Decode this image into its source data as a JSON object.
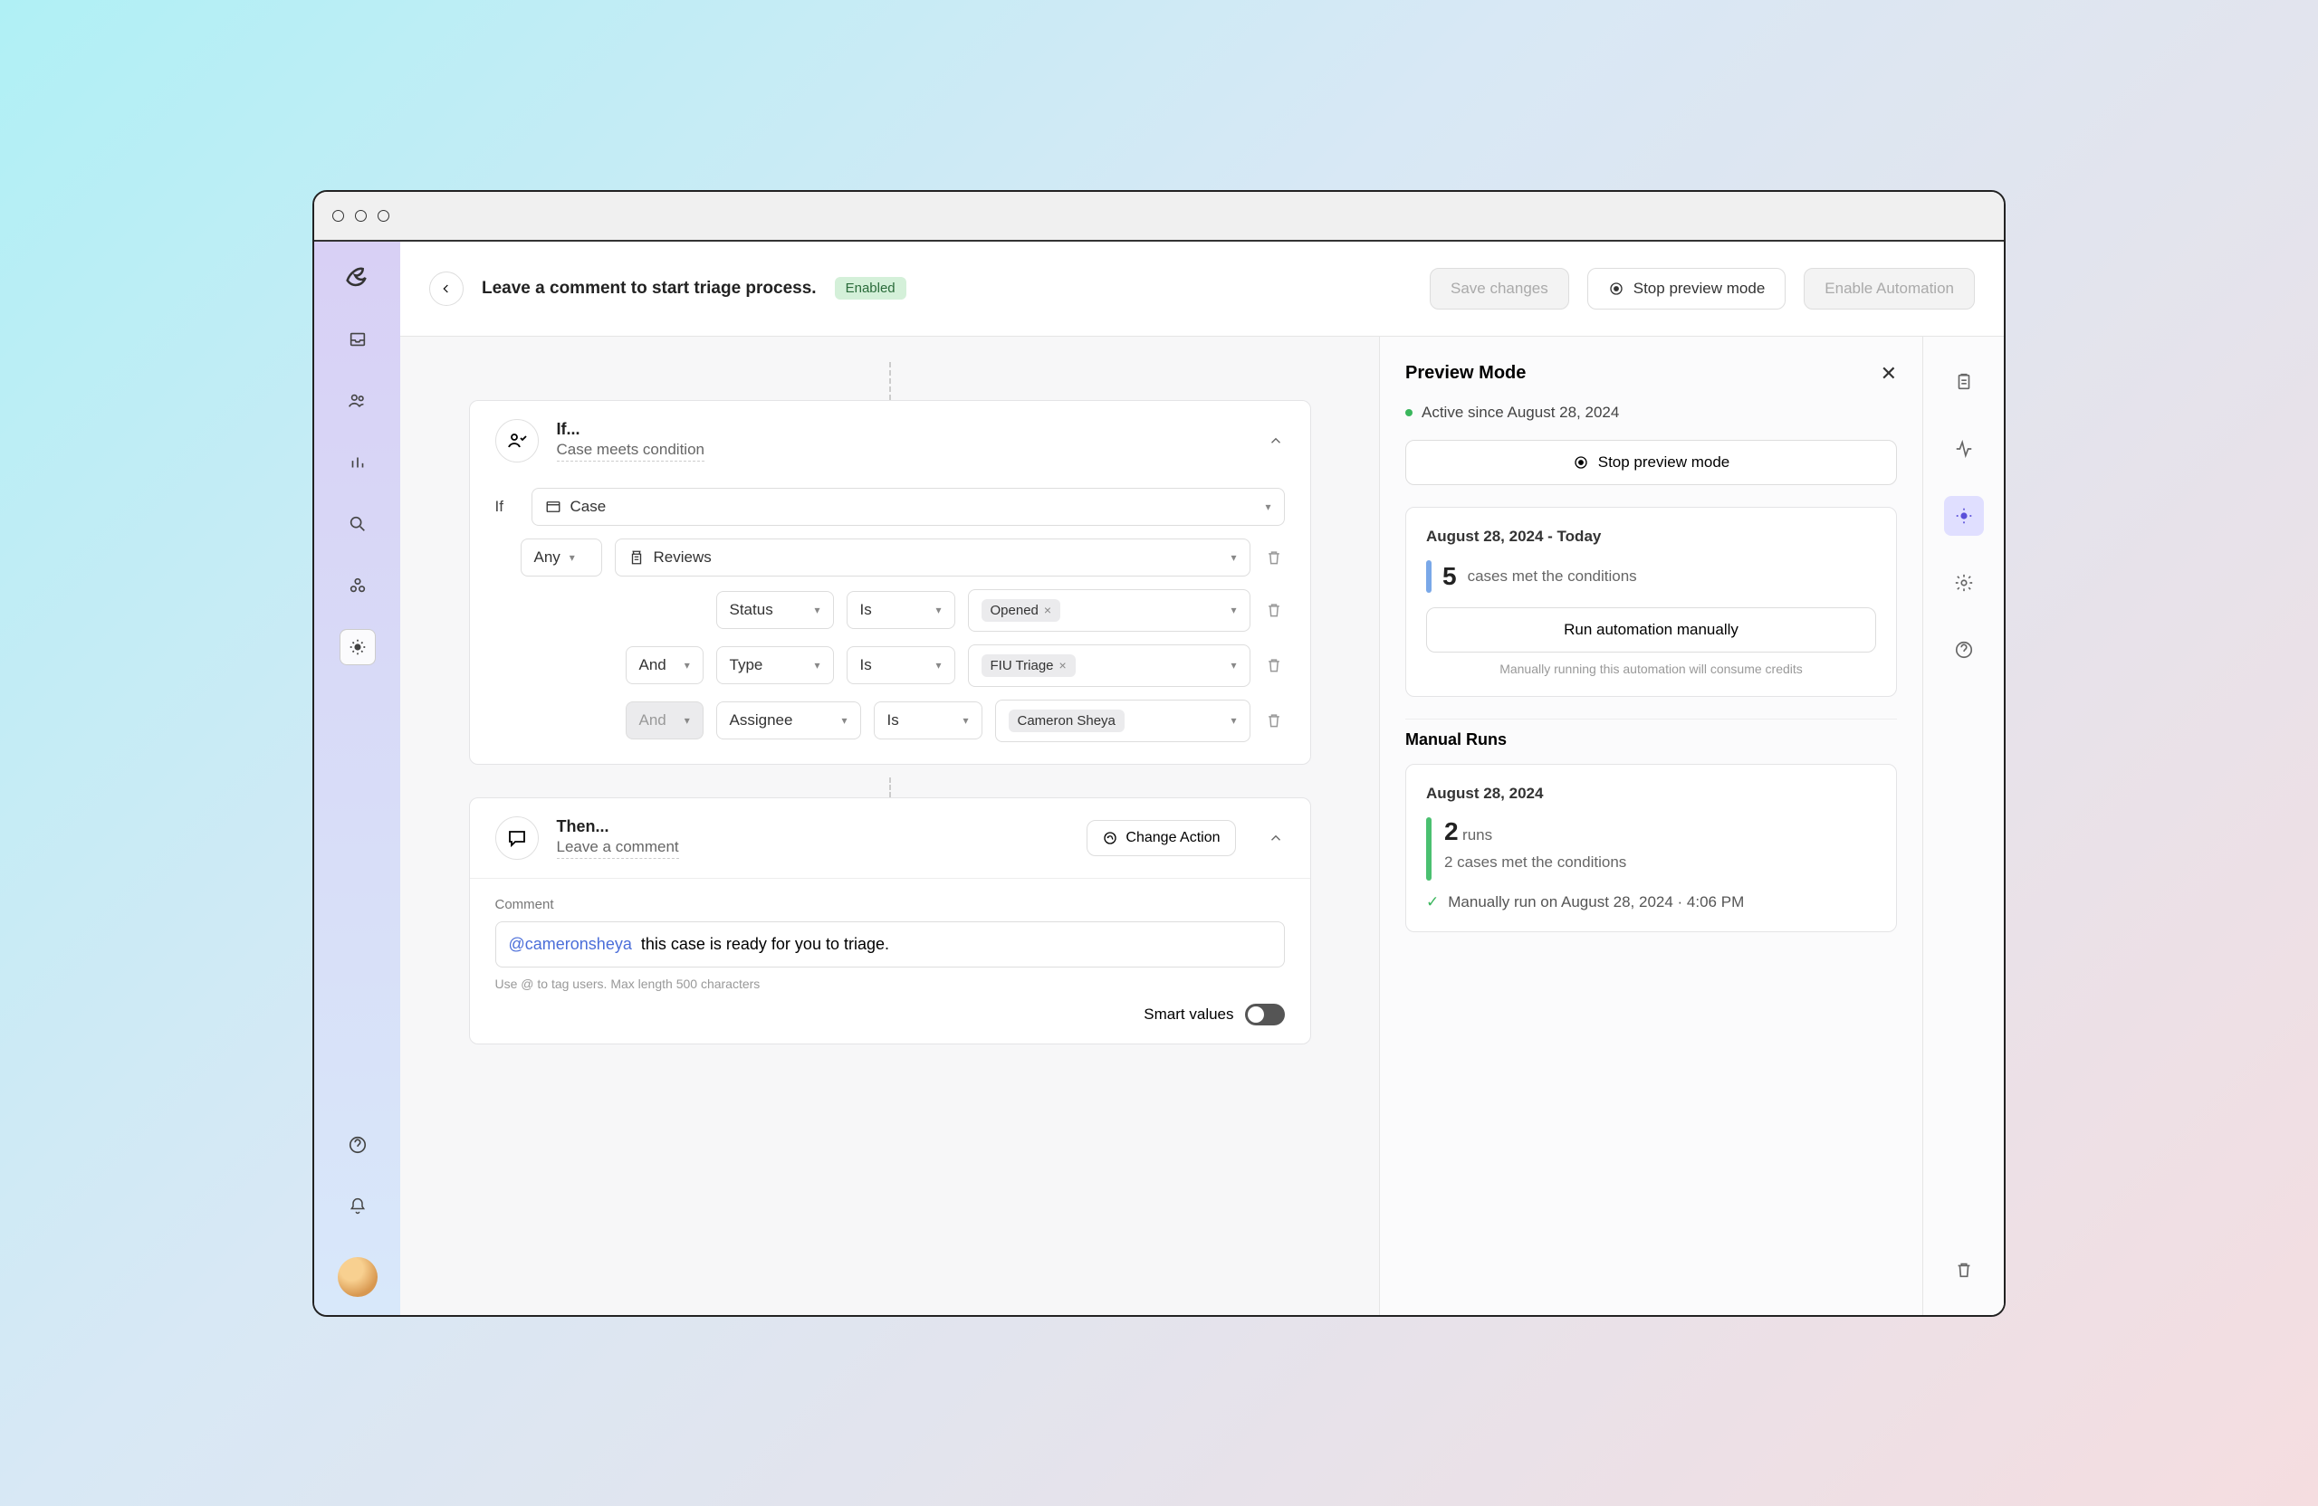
{
  "header": {
    "title": "Leave a comment to start triage process.",
    "enabled_badge": "Enabled",
    "save_label": "Save changes",
    "stop_preview_label": "Stop preview mode",
    "enable_automation_label": "Enable Automation"
  },
  "if_card": {
    "title": "If...",
    "subtitle": "Case meets condition",
    "if_label": "If",
    "entity": "Case",
    "any_label": "Any",
    "attribute": "Reviews",
    "rows": [
      {
        "conj": "",
        "field": "Status",
        "op": "Is",
        "value": "Opened"
      },
      {
        "conj": "And",
        "field": "Type",
        "op": "Is",
        "value": "FIU Triage"
      },
      {
        "conj": "And",
        "field": "Assignee",
        "op": "Is",
        "value": "Cameron Sheya"
      }
    ]
  },
  "then_card": {
    "title": "Then...",
    "subtitle": "Leave a comment",
    "change_action": "Change Action",
    "comment_label": "Comment",
    "mention": "@cameronsheya",
    "comment_text": "this case is ready for you to triage.",
    "help": "Use @ to tag users. Max length 500 characters",
    "smart_values": "Smart values"
  },
  "preview": {
    "title": "Preview Mode",
    "active_since": "Active since August 28, 2024",
    "stop_label": "Stop preview mode",
    "range": "August 28, 2024 - Today",
    "count": "5",
    "count_suffix": "cases met the conditions",
    "run_manual": "Run automation manually",
    "credits": "Manually running this automation will consume credits",
    "manual_runs_label": "Manual Runs",
    "run_date": "August 28, 2024",
    "run_count": "2",
    "runs_suffix": "runs",
    "run_detail": "2 cases met the conditions",
    "run_timestamp": "Manually run on August 28, 2024 · 4:06 PM"
  }
}
